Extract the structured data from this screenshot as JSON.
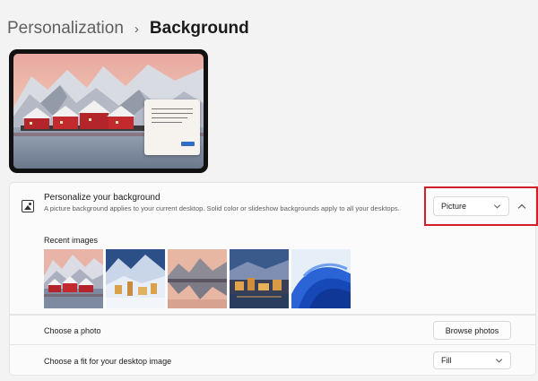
{
  "breadcrumb": {
    "parent": "Personalization",
    "separator": "›",
    "current": "Background"
  },
  "background_setting": {
    "icon": "picture-icon",
    "title": "Personalize your background",
    "description": "A picture background applies to your current desktop. Solid color or slideshow backgrounds apply to all your desktops.",
    "selected": "Picture"
  },
  "recent_images": {
    "label": "Recent images",
    "items": [
      {
        "name": "red-cabins-mountains"
      },
      {
        "name": "snowy-village-night"
      },
      {
        "name": "lake-reflection-mountains"
      },
      {
        "name": "town-at-dusk"
      },
      {
        "name": "blue-bloom"
      }
    ]
  },
  "choose_photo": {
    "label": "Choose a photo",
    "button": "Browse photos"
  },
  "choose_fit": {
    "label": "Choose a fit for your desktop image",
    "selected": "Fill"
  },
  "colors": {
    "highlight": "#d0202a",
    "accent": "#2f6ec3"
  }
}
